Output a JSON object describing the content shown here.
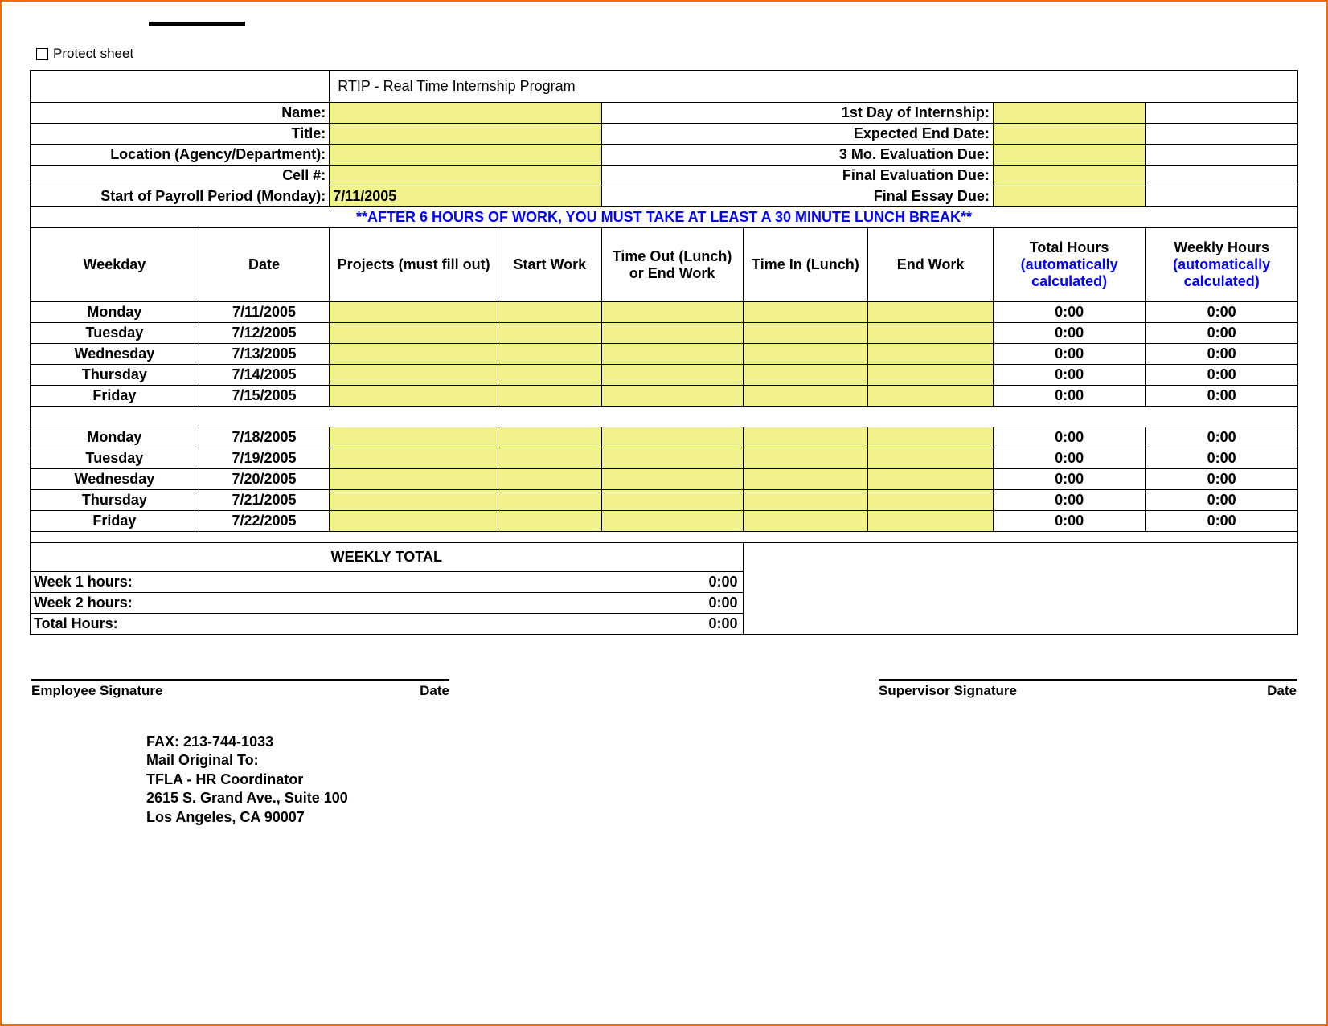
{
  "protect_label": "Protect sheet",
  "title": "RTIP - Real Time Internship Program",
  "info_rows": [
    {
      "l1": "Name:",
      "v1": "",
      "l2": "1st Day of Internship:",
      "v2": ""
    },
    {
      "l1": "Title:",
      "v1": "",
      "l2": "Expected End Date:",
      "v2": ""
    },
    {
      "l1": "Location (Agency/Department):",
      "v1": "",
      "l2": "3 Mo. Evaluation Due:",
      "v2": ""
    },
    {
      "l1": "Cell #:",
      "v1": "",
      "l2": "Final Evaluation Due:",
      "v2": ""
    },
    {
      "l1": "Start of Payroll Period (Monday):",
      "v1": "7/11/2005",
      "l2": "Final Essay Due:",
      "v2": ""
    }
  ],
  "notice": "**AFTER 6 HOURS OF WORK, YOU MUST TAKE AT LEAST A 30 MINUTE LUNCH BREAK**",
  "columns": {
    "weekday": "Weekday",
    "date": "Date",
    "projects": "Projects (must fill out)",
    "start": "Start Work",
    "out": "Time Out (Lunch) or End Work",
    "in": "Time In (Lunch)",
    "end": "End Work",
    "total_hours_a": "Total Hours",
    "total_hours_b": "(automatically calculated)",
    "weekly_hours_a": "Weekly Hours",
    "weekly_hours_b": "(automatically calculated)"
  },
  "week1": [
    {
      "day": "Monday",
      "date": "7/11/2005",
      "total": "0:00",
      "weekly": "0:00"
    },
    {
      "day": "Tuesday",
      "date": "7/12/2005",
      "total": "0:00",
      "weekly": "0:00"
    },
    {
      "day": "Wednesday",
      "date": "7/13/2005",
      "total": "0:00",
      "weekly": "0:00"
    },
    {
      "day": "Thursday",
      "date": "7/14/2005",
      "total": "0:00",
      "weekly": "0:00"
    },
    {
      "day": "Friday",
      "date": "7/15/2005",
      "total": "0:00",
      "weekly": "0:00"
    }
  ],
  "week2": [
    {
      "day": "Monday",
      "date": "7/18/2005",
      "total": "0:00",
      "weekly": "0:00"
    },
    {
      "day": "Tuesday",
      "date": "7/19/2005",
      "total": "0:00",
      "weekly": "0:00"
    },
    {
      "day": "Wednesday",
      "date": "7/20/2005",
      "total": "0:00",
      "weekly": "0:00"
    },
    {
      "day": "Thursday",
      "date": "7/21/2005",
      "total": "0:00",
      "weekly": "0:00"
    },
    {
      "day": "Friday",
      "date": "7/22/2005",
      "total": "0:00",
      "weekly": "0:00"
    }
  ],
  "weekly_total_header": "WEEKLY TOTAL",
  "totals": [
    {
      "label": "Week 1 hours:",
      "value": "0:00"
    },
    {
      "label": "Week 2 hours:",
      "value": "0:00"
    },
    {
      "label": "Total Hours:",
      "value": "0:00"
    }
  ],
  "signatures": {
    "emp": "Employee Signature",
    "date": "Date",
    "sup": "Supervisor Signature"
  },
  "contact": {
    "fax": "FAX:  213-744-1033",
    "mail_to": "Mail Original To:",
    "line1": "TFLA - HR Coordinator",
    "line2": "2615 S. Grand Ave., Suite 100",
    "line3": "Los Angeles, CA 90007"
  }
}
